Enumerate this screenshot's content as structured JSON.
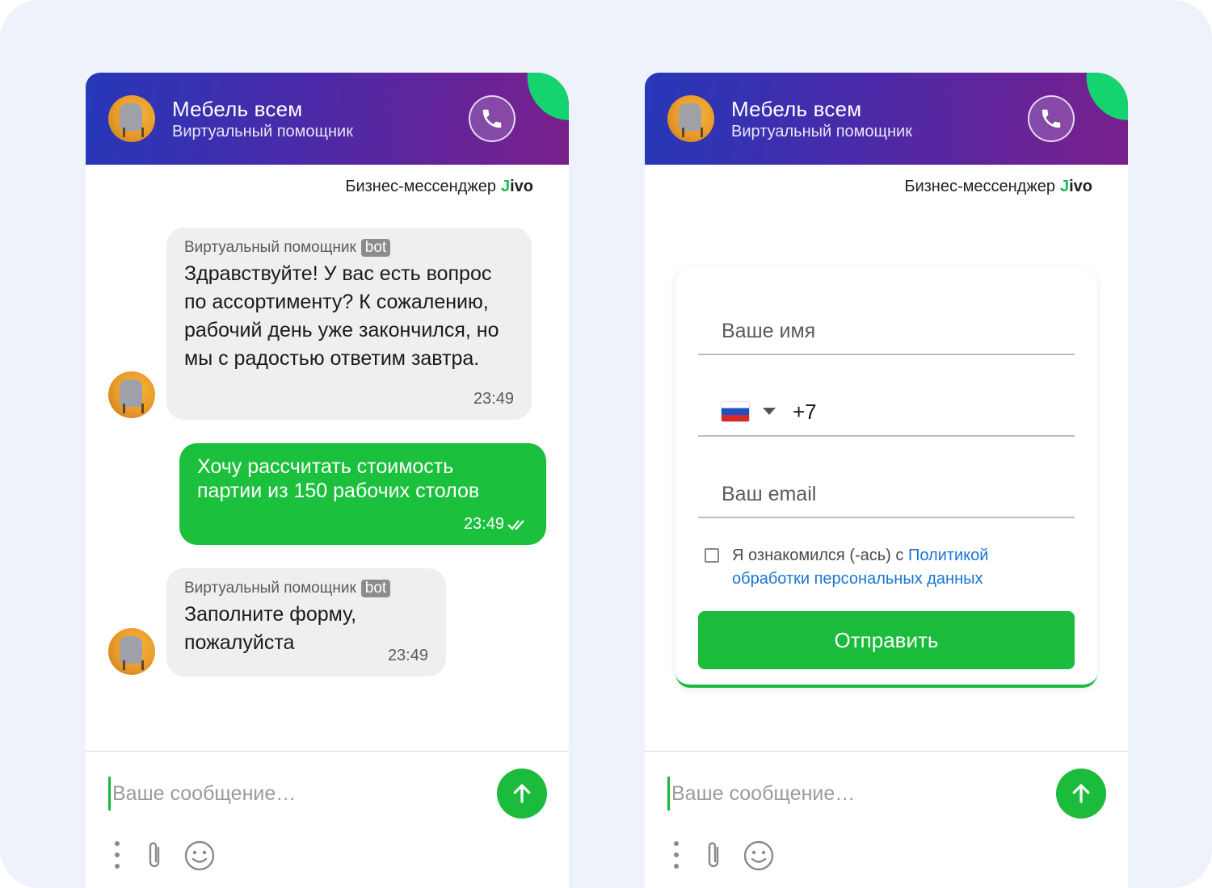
{
  "widgets": [
    {
      "header": {
        "title": "Мебель всем",
        "subtitle": "Виртуальный помощник"
      },
      "brand": {
        "label": "Бизнес-мессенджер",
        "logo_mark": "J",
        "logo_text": "ivo"
      },
      "messages": [
        {
          "direction": "in",
          "sender": "Виртуальный помощник",
          "badge": "bot",
          "text": "Здравствуйте! У вас есть вопрос по ассортименту? К сожалению, рабочий день уже закончился, но мы с радостью ответим завтра.",
          "time": "23:49"
        },
        {
          "direction": "out",
          "text": "Хочу рассчитать стоимость партии из 150 рабочих столов",
          "time": "23:49",
          "status_icon": "double-check-icon"
        },
        {
          "direction": "in",
          "sender": "Виртуальный помощник",
          "badge": "bot",
          "text": "Заполните форму, пожалуйста",
          "time": "23:49"
        }
      ],
      "composer": {
        "placeholder": "Ваше сообщение…"
      }
    },
    {
      "header": {
        "title": "Мебель всем",
        "subtitle": "Виртуальный помощник"
      },
      "brand": {
        "label": "Бизнес-мессенджер",
        "logo_mark": "J",
        "logo_text": "ivo"
      },
      "form": {
        "name_placeholder": "Ваше имя",
        "phone_country_flag": "russia-flag-icon",
        "phone_code": "+7",
        "email_placeholder": "Ваш email",
        "consent_text": "Я ознакомился (-ась) с ",
        "consent_link": "Политикой обработки персональных данных",
        "consent_checked": false,
        "submit_label": "Отправить"
      },
      "composer": {
        "placeholder": "Ваше сообщение…"
      }
    }
  ],
  "colors": {
    "accent_green": "#1bbb3b",
    "header_gradient_start": "#2638b8",
    "header_gradient_end": "#7a1f8c",
    "link_blue": "#1976d2"
  }
}
